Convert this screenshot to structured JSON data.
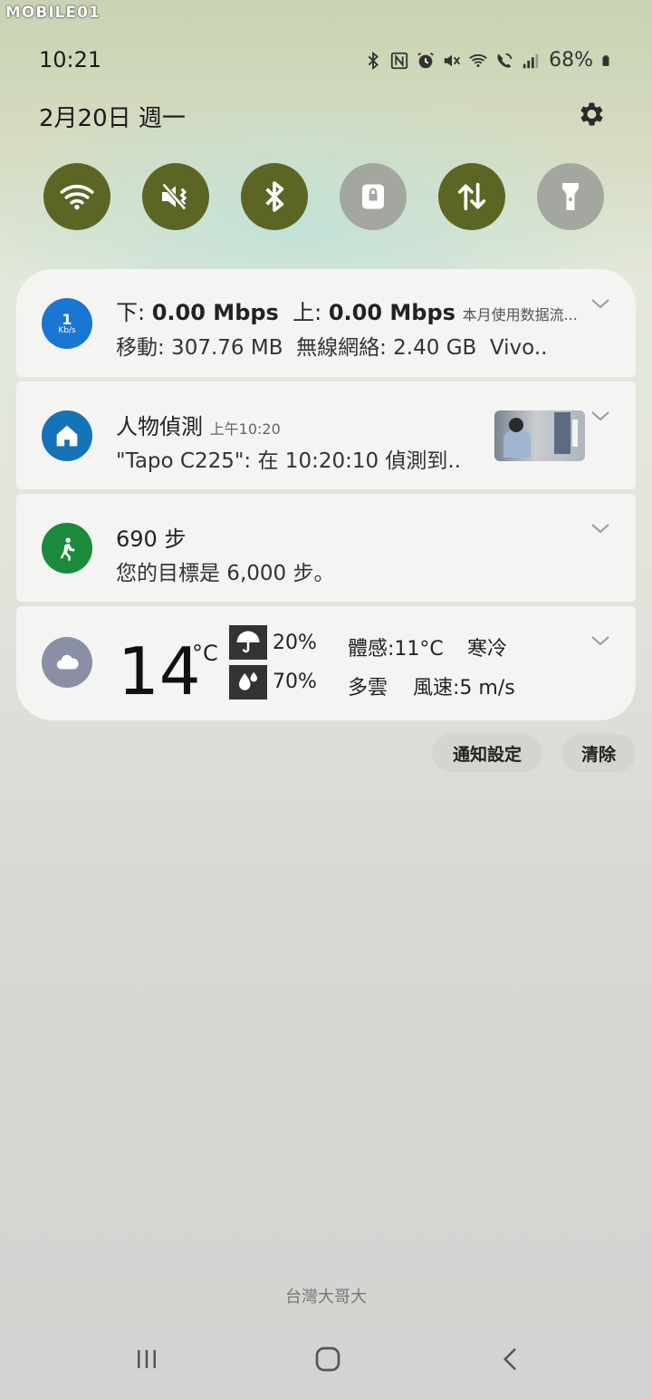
{
  "watermark": "MOBILE01",
  "status_bar": {
    "time": "10:21",
    "battery": "68%",
    "icons": [
      "bluetooth-icon",
      "nfc-icon",
      "alarm-icon",
      "mute-icon",
      "wifi-call-icon",
      "volte-icon",
      "signal-icon",
      "battery-icon"
    ]
  },
  "panel": {
    "date": "2月20日 週一"
  },
  "quick_settings": [
    {
      "name": "wifi",
      "icon": "wifi-icon",
      "state": "on"
    },
    {
      "name": "sound",
      "icon": "mute-icon",
      "state": "on"
    },
    {
      "name": "bluetooth",
      "icon": "bluetooth-icon",
      "state": "on"
    },
    {
      "name": "rotation-lock",
      "icon": "lock-icon",
      "state": "off"
    },
    {
      "name": "mobile-data",
      "icon": "data-arrows-icon",
      "state": "on"
    },
    {
      "name": "flashlight",
      "icon": "flashlight-icon",
      "state": "off"
    }
  ],
  "notifications": {
    "speed": {
      "icon_value": "1",
      "icon_unit": "Kb/s",
      "down_label": "下:",
      "down_value": "0.00 Mbps",
      "up_label": "上:",
      "up_value": "0.00 Mbps",
      "extra": "本月使用数据流...",
      "mobile": "移動: 307.76 MB",
      "wifi": "無線網絡: 2.40 GB",
      "carrier": "Vivo.."
    },
    "camera": {
      "title": "人物偵測",
      "time": "上午10:20",
      "body": "\"Tapo C225\": 在 10:20:10 偵測到.."
    },
    "steps": {
      "title": "690 步",
      "body": "您的目標是 6,000 步。"
    },
    "weather": {
      "temp": "14",
      "unit": "°C",
      "rain_chance": "20%",
      "humidity": "70%",
      "feels_like": "體感:11°C",
      "condition_1": "寒冷",
      "condition_2": "多雲",
      "wind": "風速:5 m/s"
    }
  },
  "actions": {
    "settings_label": "通知設定",
    "clear_label": "清除"
  },
  "carrier_label": "台灣大哥大",
  "colors": {
    "toggle_on": "#5d6524",
    "toggle_off": "#a3a79f",
    "speed_icon": "#1976d2",
    "camera_icon": "#1573b8",
    "steps_icon": "#1a8a3c",
    "weather_icon": "#8a8fa5"
  }
}
